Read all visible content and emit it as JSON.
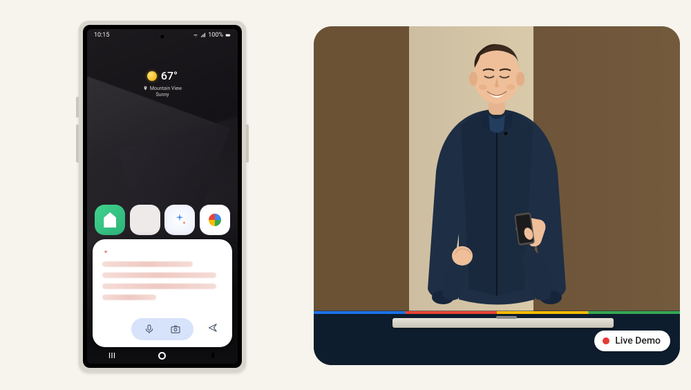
{
  "phone": {
    "status": {
      "time": "10:15",
      "battery": "100%"
    },
    "weather": {
      "temp": "67°",
      "location": "Mountain View",
      "condition": "Sunny"
    },
    "dock": {
      "app1_name": "health-app",
      "app2_name": "settings-app",
      "app3_name": "ai-assistant-app",
      "app4_name": "photos-app"
    },
    "nav": {
      "recent": "recent",
      "home": "home",
      "back": "back"
    }
  },
  "badge": {
    "label": "Live Demo"
  }
}
